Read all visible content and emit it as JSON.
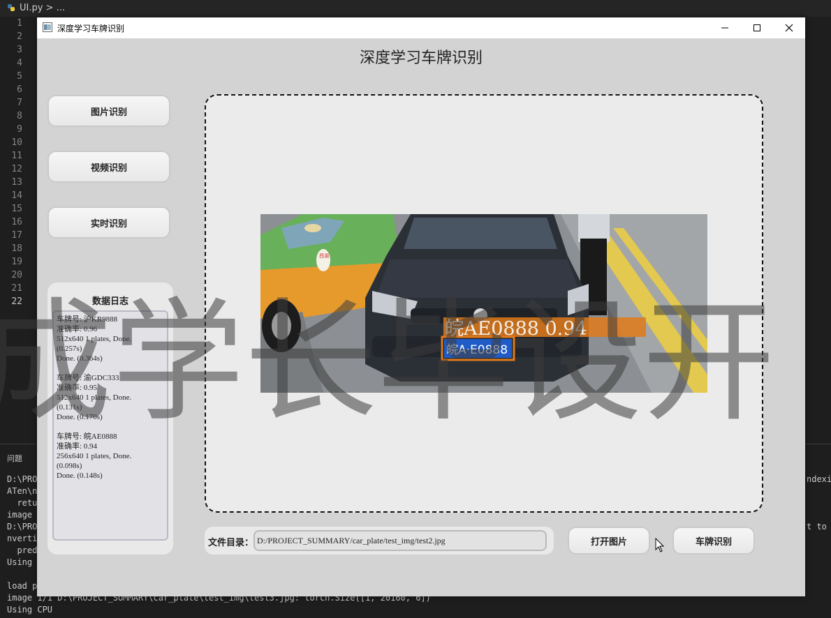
{
  "editor": {
    "tab_label": "UI.py > ...",
    "line_numbers": [
      "1",
      "2",
      "3",
      "4",
      "5",
      "6",
      "7",
      "8",
      "9",
      "10",
      "11",
      "12",
      "13",
      "14",
      "15",
      "16",
      "17",
      "18",
      "19",
      "20",
      "21",
      "22"
    ]
  },
  "terminal": {
    "panel_title": "问题",
    "lines": [
      "D:\\PRO",
      "ATen\\n",
      "  retu",
      "image ",
      "D:\\PRO",
      "nverti",
      "  pred",
      "Using ",
      "",
      "load p",
      "image 1/1 D:\\PROJECT_SUMMARY\\car_plate\\test_img\\test3.jpg: torch.Size([1, 20160, 6])",
      "Using CPU"
    ],
    "right_lines": [
      "ndexin",
      "",
      "",
      "",
      "t to a"
    ]
  },
  "window": {
    "title": "深度学习车牌识别",
    "app_title": "深度学习车牌识别"
  },
  "sidebar": {
    "buttons": [
      "图片识别",
      "视频识别",
      "实时识别"
    ]
  },
  "log": {
    "title": "数据日志",
    "text": "车牌号: 沪KR9888\n准确率: 0.96\n512x640 1 plates, Done.\n(0.257s)\nDone. (0.364s)\n\n车牌号: 渝GDC333\n准确率: 0.95\n512x640 1 plates, Done.\n(0.131s)\nDone. (0.170s)\n\n车牌号: 皖AE0888\n准确率: 0.94\n256x640 1 plates, Done.\n(0.098s)\nDone. (0.148s)"
  },
  "detection": {
    "label": "皖AE0888 0.94",
    "plate_text": "皖A·E0888",
    "box_color": "#e07a1a"
  },
  "taxi_sign": "西湖",
  "file": {
    "label": "文件目录：",
    "path": "D:/PROJECT_SUMMARY/car_plate/test_img/test2.jpg"
  },
  "actions": {
    "open": "打开图片",
    "recognize": "车牌识别"
  },
  "watermark": "成学长毕设开"
}
